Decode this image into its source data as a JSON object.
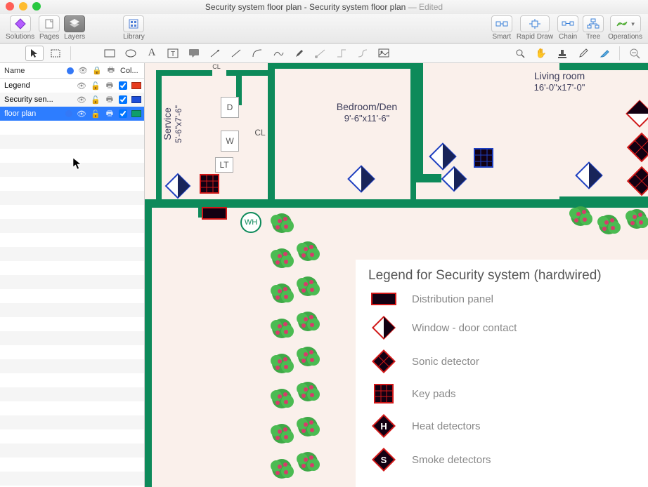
{
  "title": {
    "main": "Security system floor plan - Security system floor plan",
    "suffix": " — Edited"
  },
  "toolbar": {
    "solutions": "Solutions",
    "pages": "Pages",
    "layers": "Layers",
    "library": "Library",
    "smart": "Smart",
    "rapid_draw": "Rapid Draw",
    "chain": "Chain",
    "tree": "Tree",
    "operations": "Operations"
  },
  "layers_panel": {
    "head_name": "Name",
    "head_col": "Col...",
    "rows": [
      {
        "name": "Legend",
        "color": "#e63c1f"
      },
      {
        "name": "Security sen...",
        "color": "#1d4ed8"
      },
      {
        "name": "floor plan",
        "color": "#0f9e6b"
      }
    ]
  },
  "plan": {
    "living_room": {
      "name": "Living room",
      "dim": "16'-0\"x17'-0\""
    },
    "bedroom": {
      "name": "Bedroom/Den",
      "dim": "9'-6\"x11'-6\""
    },
    "service": {
      "name": "Service",
      "dim": "5'-6\"x7'-6\""
    },
    "labels": {
      "cl1": "CL",
      "cl2": "CL",
      "d": "D",
      "w": "W",
      "lt": "LT",
      "wh": "WH"
    }
  },
  "legend": {
    "title": "Legend for Security system (hardwired)",
    "items": [
      {
        "label": "Distribution panel"
      },
      {
        "label": "Window - door contact"
      },
      {
        "label": "Sonic detector"
      },
      {
        "label": "Key pads"
      },
      {
        "label": "Heat detectors"
      },
      {
        "label": "Smoke detectors"
      }
    ]
  }
}
